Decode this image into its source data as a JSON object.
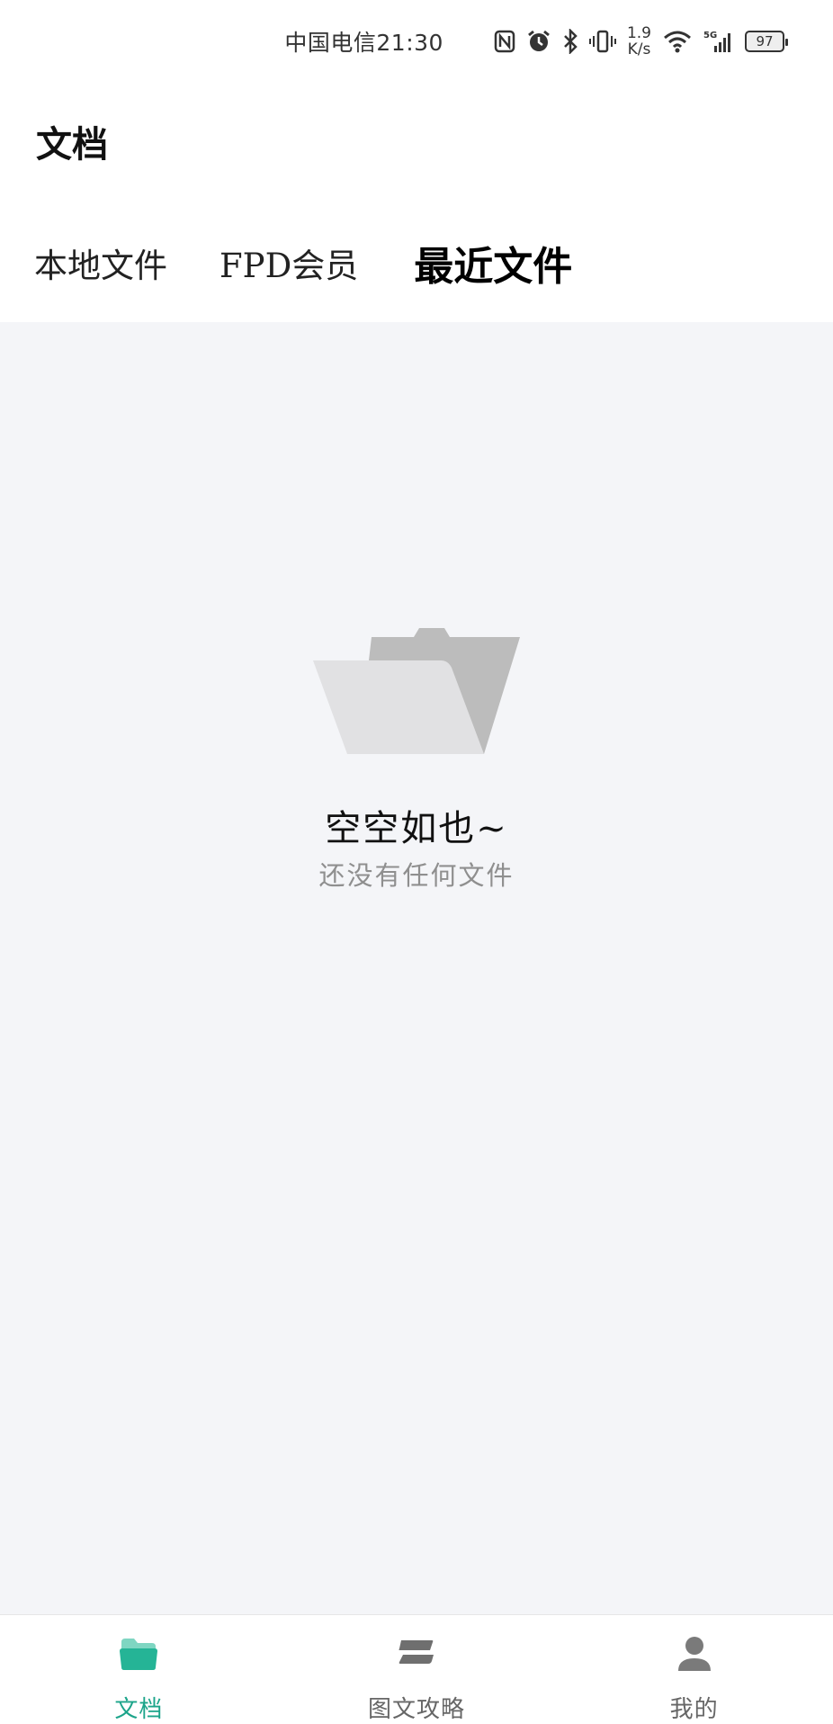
{
  "status_bar": {
    "carrier": "中国电信",
    "time": "21:30",
    "net_speed_value": "1.9",
    "net_speed_unit": "K/s",
    "battery": "97",
    "icons": [
      "nfc-icon",
      "alarm-icon",
      "bluetooth-icon",
      "vibrate-icon",
      "wifi-icon",
      "signal-5g-icon",
      "battery-icon"
    ]
  },
  "header": {
    "title": "文档"
  },
  "tabs": [
    {
      "label": "本地文件",
      "active": false
    },
    {
      "label": "FPD会员",
      "active": false
    },
    {
      "label": "最近文件",
      "active": true
    }
  ],
  "empty_state": {
    "icon": "empty-folder-icon",
    "title": "空空如也~",
    "subtitle": "还没有任何文件"
  },
  "bottom_nav": {
    "accent_color": "#1ca48a",
    "items": [
      {
        "label": "文档",
        "icon": "folder-icon",
        "active": true
      },
      {
        "label": "图文攻略",
        "icon": "layers-icon",
        "active": false
      },
      {
        "label": "我的",
        "icon": "user-icon",
        "active": false
      }
    ]
  }
}
